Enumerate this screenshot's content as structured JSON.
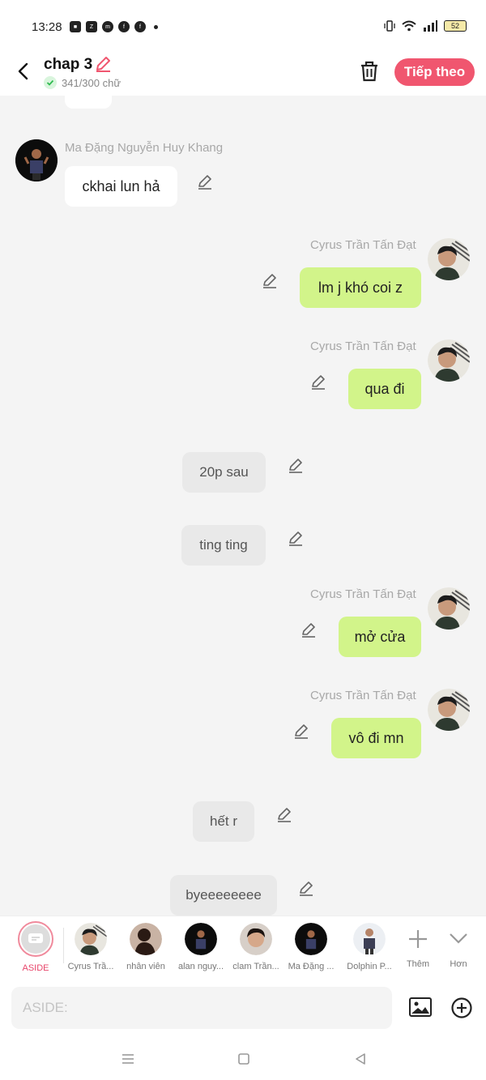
{
  "status": {
    "time": "13:28",
    "battery": "52"
  },
  "header": {
    "title": "chap 3",
    "word_count": "341/300 chữ",
    "next_label": "Tiếp theo"
  },
  "messages": [
    {
      "sender": "Ma Đặng Nguyễn Huy Khang",
      "text": "ckhai lun hả"
    },
    {
      "sender": "Cyrus Trần Tấn Đạt",
      "text": "lm j khó coi z"
    },
    {
      "sender": "Cyrus Trần Tấn Đạt",
      "text": "qua đi"
    },
    {
      "sender": "",
      "text": "20p sau"
    },
    {
      "sender": "",
      "text": "ting ting"
    },
    {
      "sender": "Cyrus Trần Tấn Đạt",
      "text": "mở cửa"
    },
    {
      "sender": "Cyrus Trần Tấn Đạt",
      "text": "vô đi mn"
    },
    {
      "sender": "",
      "text": "hết r"
    },
    {
      "sender": "",
      "text": "byeeeeeeee"
    }
  ],
  "characters": [
    {
      "label": "ASIDE"
    },
    {
      "label": "Cyrus Trầ..."
    },
    {
      "label": "nhân viên"
    },
    {
      "label": "alan nguy..."
    },
    {
      "label": "clam Trần..."
    },
    {
      "label": "Ma Đặng ..."
    },
    {
      "label": "Dolphin P..."
    },
    {
      "label": "Thêm"
    },
    {
      "label": "Hơn"
    }
  ],
  "input": {
    "placeholder": "ASIDE:"
  },
  "colors": {
    "accent": "#f0566f",
    "own_bubble": "#d2f48a",
    "other_bubble": "#ffffff",
    "aside_bubble": "#e9e9e9"
  }
}
